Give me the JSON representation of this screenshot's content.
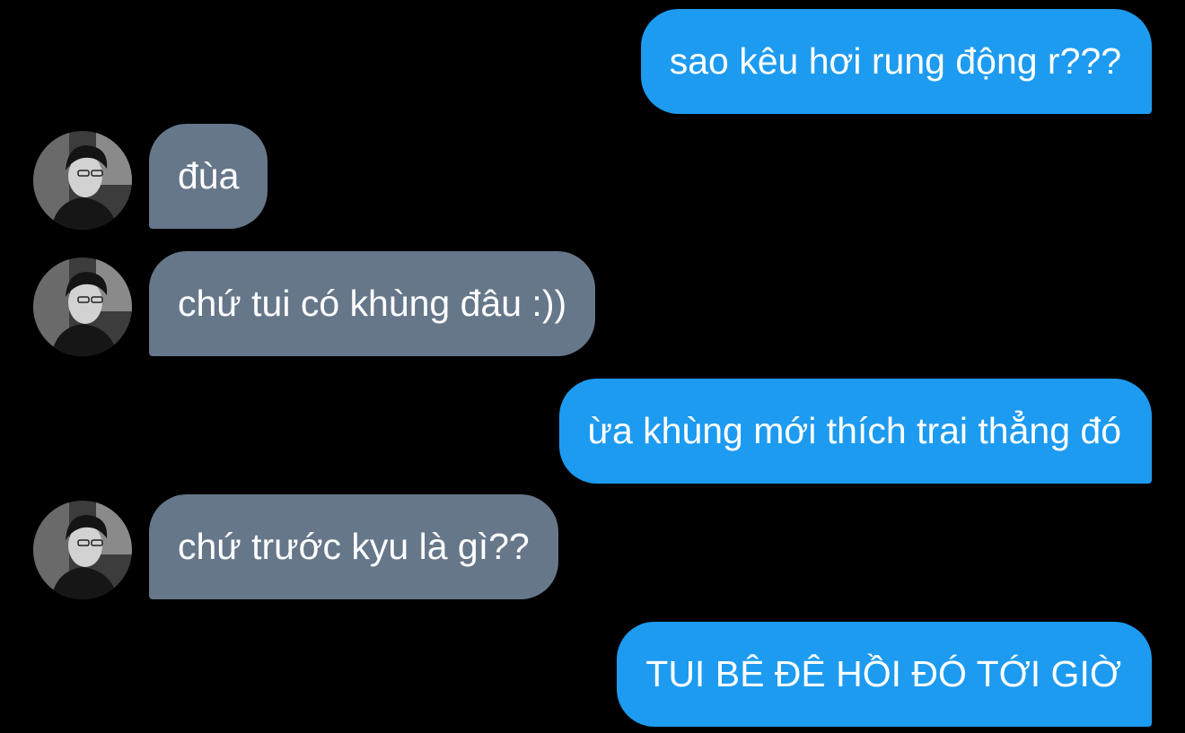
{
  "conversation": {
    "messages": [
      {
        "sender": "me",
        "text": "sao kêu hơi rung động r???"
      },
      {
        "sender": "other",
        "text": "đùa"
      },
      {
        "sender": "other",
        "text": "chứ tui có khùng đâu :))"
      },
      {
        "sender": "me",
        "text": "ừa khùng mới thích trai thẳng đó"
      },
      {
        "sender": "other",
        "text": "chứ trước kyu là gì??"
      },
      {
        "sender": "me",
        "text": "TUI BÊ ĐÊ HỒI ĐÓ TỚI GIỜ"
      }
    ]
  },
  "colors": {
    "background": "#000000",
    "sent_bubble": "#1d9bf0",
    "received_bubble": "#66778a",
    "text": "#ffffff"
  },
  "icons": {
    "avatar": "user-avatar-photo"
  }
}
